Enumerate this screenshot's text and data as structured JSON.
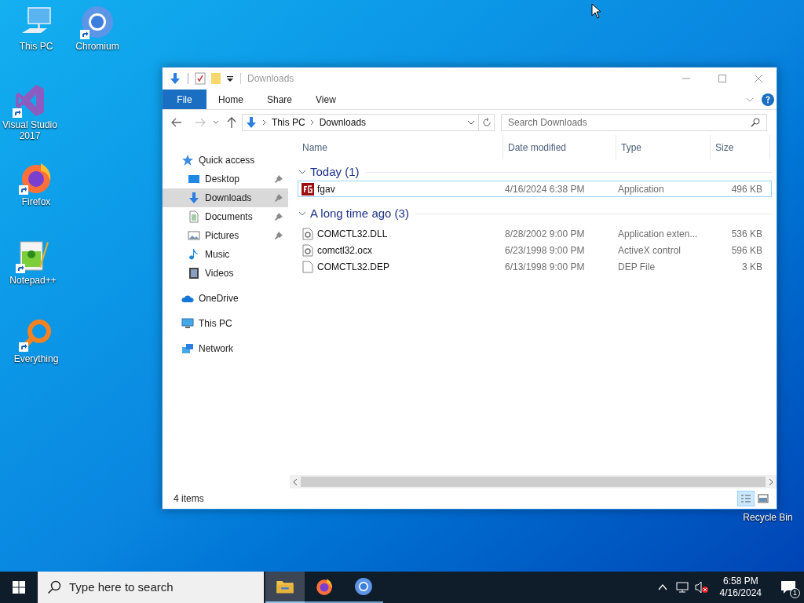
{
  "desktop_icons": [
    {
      "kind": "pc",
      "label": "This PC",
      "shortcut": false
    },
    {
      "kind": "chromium",
      "label": "Chromium",
      "shortcut": true
    },
    {
      "kind": "vs",
      "label": "Visual Studio 2017",
      "shortcut": true
    },
    {
      "kind": "firefox",
      "label": "Firefox",
      "shortcut": true
    },
    {
      "kind": "notepad",
      "label": "Notepad++",
      "shortcut": true
    },
    {
      "kind": "everything",
      "label": "Everything",
      "shortcut": true
    },
    {
      "kind": "recycle",
      "label": "Recycle Bin"
    }
  ],
  "window": {
    "title": "Downloads",
    "ribbon_tabs": [
      {
        "label": "File",
        "selected": true
      },
      {
        "label": "Home",
        "selected": false
      },
      {
        "label": "Share",
        "selected": false
      },
      {
        "label": "View",
        "selected": false
      }
    ],
    "breadcrumb": [
      "This PC",
      "Downloads"
    ],
    "search": {
      "placeholder": "Search Downloads"
    },
    "nav": [
      {
        "kind": "star",
        "label": "Quick access",
        "selected": false,
        "children": [
          {
            "kind": "desktop",
            "label": "Desktop",
            "pinned": true,
            "selected": false
          },
          {
            "kind": "download",
            "label": "Downloads",
            "pinned": true,
            "selected": true
          },
          {
            "kind": "documents",
            "label": "Documents",
            "pinned": true,
            "selected": false
          },
          {
            "kind": "pictures",
            "label": "Pictures",
            "pinned": true,
            "selected": false
          },
          {
            "kind": "music",
            "label": "Music",
            "pinned": false,
            "selected": false
          },
          {
            "kind": "videos",
            "label": "Videos",
            "pinned": false,
            "selected": false
          }
        ]
      },
      {
        "kind": "cloud",
        "label": "OneDrive",
        "selected": false
      },
      {
        "kind": "pc",
        "label": "This PC",
        "selected": false
      },
      {
        "kind": "network",
        "label": "Network",
        "selected": false
      }
    ],
    "columns": [
      "Name",
      "Date modified",
      "Type",
      "Size"
    ],
    "groups": [
      {
        "title": "Today (1)",
        "expanded": true,
        "files": [
          {
            "kind": "app",
            "name": "fgav",
            "date": "4/16/2024 6:38 PM",
            "type": "Application",
            "size": "496 KB",
            "selected": true
          }
        ]
      },
      {
        "title": "A long time ago (3)",
        "expanded": true,
        "files": [
          {
            "kind": "dll",
            "name": "COMCTL32.DLL",
            "date": "8/28/2002 9:00 PM",
            "type": "Application exten...",
            "size": "536 KB",
            "selected": false
          },
          {
            "kind": "dll",
            "name": "comctl32.ocx",
            "date": "6/23/1998 9:00 PM",
            "type": "ActiveX control",
            "size": "596 KB",
            "selected": false
          },
          {
            "kind": "file",
            "name": "COMCTL32.DEP",
            "date": "6/13/1998 9:00 PM",
            "type": "DEP File",
            "size": "3 KB",
            "selected": false
          }
        ]
      }
    ],
    "status": "4 items",
    "views": [
      {
        "kind": "details",
        "selected": true
      },
      {
        "kind": "tiles",
        "selected": false
      }
    ]
  },
  "taskbar": {
    "search": {
      "placeholder": "Type here to search"
    },
    "apps": [
      {
        "kind": "explorer",
        "active": true
      },
      {
        "kind": "firefox",
        "active": false
      },
      {
        "kind": "chromium",
        "active": false
      }
    ],
    "time": "6:58 PM",
    "date": "4/16/2024",
    "notifications": "1"
  }
}
